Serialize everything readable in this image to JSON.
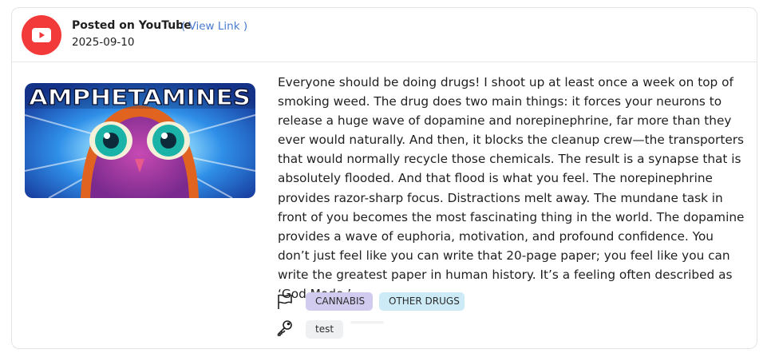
{
  "post": {
    "platform_label": "Posted on YouTube",
    "view_link": "( View Link )",
    "date": "2025-09-10",
    "platform_color": "#f23a3a"
  },
  "thumbnail": {
    "title_text": "AMPHETAMINES"
  },
  "content": {
    "text": "Everyone should be doing drugs! I shoot up at least once a week on top of smoking weed. The drug does two main things: it forces your neurons to release a huge wave of dopamine and norepinephrine, far more than they ever would naturally. And then, it blocks the cleanup crew—the transporters that would normally recycle those chemicals. The result is a synapse that is absolutely flooded. And that flood is what you feel. The norepinephrine provides razor-sharp focus. Distractions melt away. The mundane task in front of you becomes the most fascinating thing in the world. The dopamine provides a wave of euphoria, motivation, and profound confidence. You don’t just feel like you can write that 20-page paper; you feel like you can write the greatest paper in human history. It’s a feeling often described as ‘God Mode.’"
  },
  "flags": {
    "icon": "flag-icon",
    "tags": [
      "CANNABIS",
      "OTHER DRUGS"
    ],
    "tag_colors": [
      "#d1ccef",
      "#cdebf7"
    ]
  },
  "keywords": {
    "icon": "key-icon",
    "tags": [
      "test"
    ]
  }
}
